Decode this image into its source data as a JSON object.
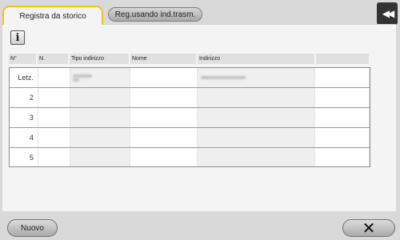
{
  "tabs": {
    "active_label": "Registra da storico",
    "inactive_label": "Reg.usando ind.trasm."
  },
  "icons": {
    "back": "double-left-arrow-icon",
    "info": "info-icon",
    "close": "close-x-icon"
  },
  "table": {
    "headers": [
      "N°",
      "N.",
      "Tipo indirizzo",
      "Nome",
      "Indirizzo",
      ""
    ],
    "rows": [
      {
        "label": "Letz."
      },
      {
        "label": "2"
      },
      {
        "label": "3"
      },
      {
        "label": "4"
      },
      {
        "label": "5"
      }
    ]
  },
  "footer": {
    "new_label": "Nuovo",
    "close_glyph": "✕"
  },
  "colors": {
    "active_tab_border": "#f2c21a",
    "back_button_bg": "#333333"
  }
}
